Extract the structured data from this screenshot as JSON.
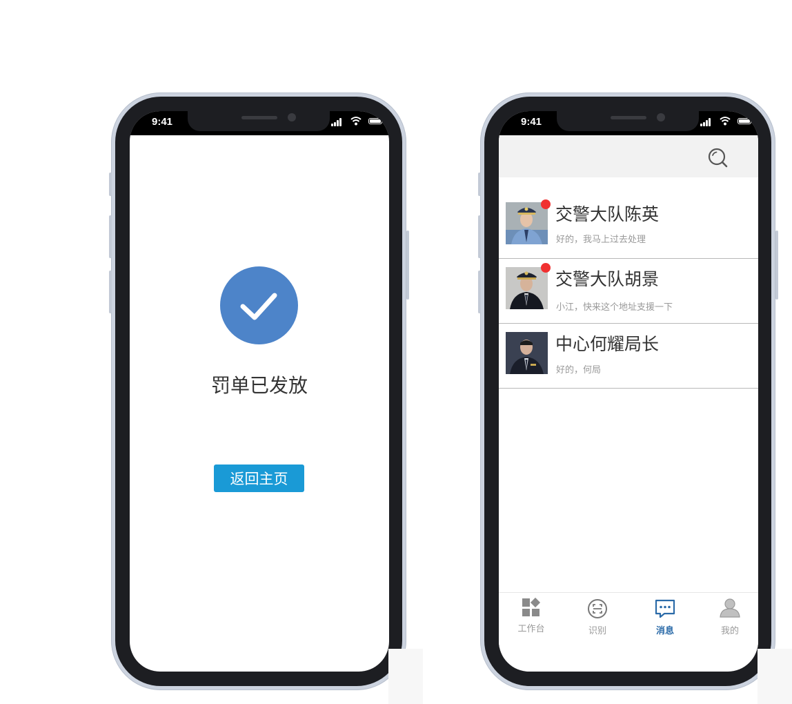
{
  "left_phone": {
    "status": {
      "time": "9:41"
    },
    "success_message": "罚单已发放",
    "home_button_label": "返回主页"
  },
  "right_phone": {
    "status": {
      "time": "9:41"
    },
    "messages": [
      {
        "name": "交警大队陈英",
        "preview": "好的，我马上过去处理",
        "unread": true
      },
      {
        "name": "交警大队胡景",
        "preview": "小江，快来这个地址支援一下",
        "unread": true
      },
      {
        "name": "中心何耀局长",
        "preview": "好的，何局",
        "unread": false
      }
    ],
    "tabs": [
      {
        "label": "工作台",
        "icon": "workbench-icon",
        "active": false
      },
      {
        "label": "识别",
        "icon": "scan-icon",
        "active": false
      },
      {
        "label": "消息",
        "icon": "message-icon",
        "active": true
      },
      {
        "label": "我的",
        "icon": "profile-icon",
        "active": false
      }
    ]
  },
  "colors": {
    "accent_button": "#1a9ad6",
    "success_circle": "#4d84c9",
    "active_tab": "#2a6aa8",
    "unread_dot": "#f03030"
  }
}
